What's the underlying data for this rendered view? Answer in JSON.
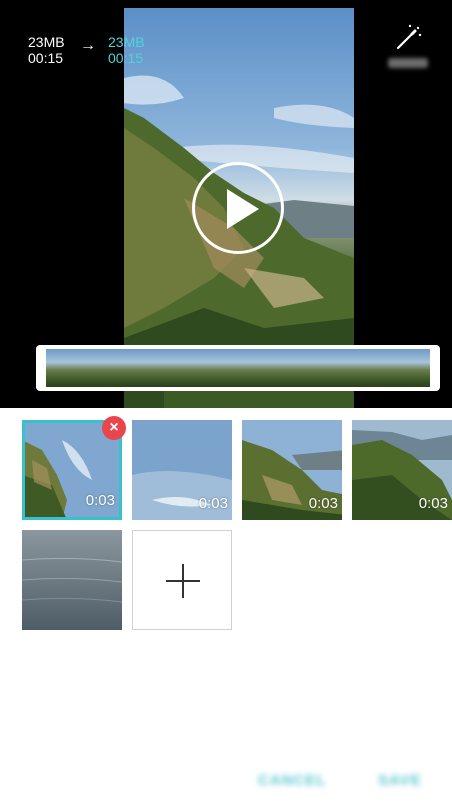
{
  "preview": {
    "original_size": "23MB",
    "original_duration": "00:15",
    "new_size": "23MB",
    "new_duration": "00:15",
    "arrow": "→"
  },
  "toolbar": {
    "magic_icon": "magic-wand-icon",
    "play_icon": "play-icon"
  },
  "clips": [
    {
      "duration": "0:03",
      "selected": true
    },
    {
      "duration": "0:03",
      "selected": false
    },
    {
      "duration": "0:03",
      "selected": false
    },
    {
      "duration": "0:03",
      "selected": false
    },
    {
      "duration": "",
      "selected": false
    }
  ],
  "remove_badge": "×",
  "add_clip_icon": "plus-icon",
  "actions": {
    "cancel": "CANCEL",
    "save": "SAVE"
  },
  "colors": {
    "accent": "#36c1cc",
    "remove": "#e8464b"
  }
}
